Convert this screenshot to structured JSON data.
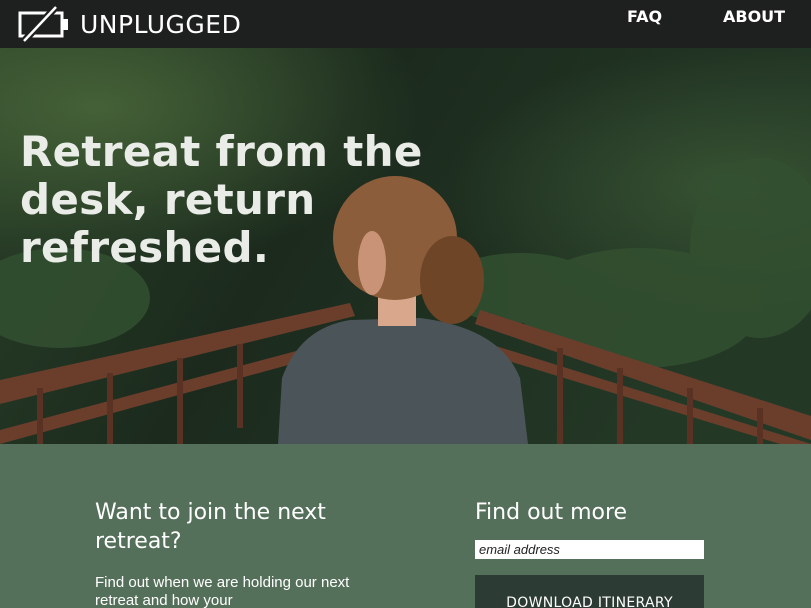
{
  "brand": {
    "name": "UNPLUGGED",
    "icon": "battery-unplugged-icon"
  },
  "nav": {
    "items": [
      {
        "label": "FAQ"
      },
      {
        "label": "ABOUT"
      }
    ]
  },
  "hero": {
    "title": "Retreat from the desk, return refreshed."
  },
  "cta": {
    "left": {
      "heading": "Want to join the next retreat?",
      "body": "Find out when we are holding our next retreat and how your"
    },
    "right": {
      "heading": "Find out more",
      "email_placeholder": "email address",
      "button_label": "DOWNLOAD ITINERARY"
    }
  },
  "colors": {
    "nav_bg": "#1e1f1f",
    "cta_bg": "#55705a",
    "button_bg": "#2c3b33",
    "text_light": "#ffffff"
  }
}
